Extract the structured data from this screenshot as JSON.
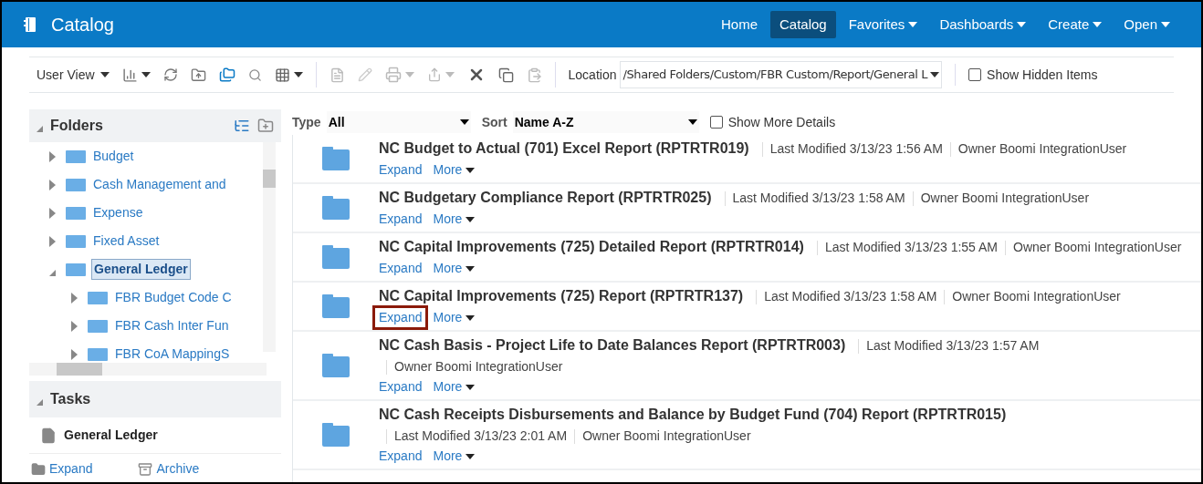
{
  "header": {
    "title": "Catalog",
    "nav": [
      {
        "label": "Home",
        "selected": false,
        "menu": false
      },
      {
        "label": "Catalog",
        "selected": true,
        "menu": false
      },
      {
        "label": "Favorites",
        "selected": false,
        "menu": true
      },
      {
        "label": "Dashboards",
        "selected": false,
        "menu": true
      },
      {
        "label": "Create",
        "selected": false,
        "menu": true
      },
      {
        "label": "Open",
        "selected": false,
        "menu": true
      }
    ]
  },
  "toolbar": {
    "view": "User View",
    "location_label": "Location",
    "location": "/Shared Folders/Custom/FBR Custom/Report/General L",
    "show_hidden": {
      "label": "Show Hidden Items",
      "checked": false
    }
  },
  "folders": {
    "title": "Folders",
    "expanded": true,
    "tree": [
      {
        "label": "Budget",
        "expanded": false,
        "selected": false
      },
      {
        "label": "Cash Management and",
        "expanded": false,
        "selected": false
      },
      {
        "label": "Expense",
        "expanded": false,
        "selected": false
      },
      {
        "label": "Fixed Asset",
        "expanded": false,
        "selected": false
      },
      {
        "label": "General Ledger",
        "expanded": true,
        "selected": true,
        "children": [
          {
            "label": "FBR Budget Code C",
            "expanded": false,
            "selected": false
          },
          {
            "label": "FBR Cash Inter Fun",
            "expanded": false,
            "selected": false
          },
          {
            "label": "FBR CoA MappingS",
            "expanded": false,
            "selected": false
          }
        ]
      }
    ]
  },
  "tasks": {
    "title": "Tasks",
    "expanded": true,
    "item": "General Ledger",
    "actions": [
      "Expand",
      "Archive"
    ]
  },
  "filters": {
    "type_label": "Type",
    "type": "All",
    "sort_label": "Sort",
    "sort": "Name A-Z",
    "show_more": {
      "label": "Show More Details",
      "checked": false
    }
  },
  "items": [
    {
      "title": "NC Budget to Actual (701) Excel Report (RPTRTR019)",
      "details": [
        "Last Modified 3/13/23 1:56 AM",
        "Owner Boomi IntegrationUser"
      ],
      "expand": "Expand",
      "more": "More",
      "highlighted": false
    },
    {
      "title": "NC Budgetary Compliance Report (RPTRTR025)",
      "details": [
        "Last Modified 3/13/23 1:58 AM",
        "Owner Boomi IntegrationUser"
      ],
      "expand": "Expand",
      "more": "More",
      "highlighted": false
    },
    {
      "title": "NC Capital Improvements (725) Detailed Report (RPTRTR014)",
      "details": [
        "Last Modified 3/13/23 1:55 AM",
        "Owner Boomi IntegrationUser"
      ],
      "expand": "Expand",
      "more": "More",
      "highlighted": false
    },
    {
      "title": "NC Capital Improvements (725) Report (RPTRTR137)",
      "details": [
        "Last Modified 3/13/23 1:58 AM",
        "Owner Boomi IntegrationUser"
      ],
      "expand": "Expand",
      "more": "More",
      "highlighted": true
    },
    {
      "title": "NC Cash Basis - Project Life to Date Balances Report (RPTRTR003)",
      "details": [
        "Last Modified 3/13/23 1:57 AM",
        "Owner Boomi IntegrationUser"
      ],
      "expand": "Expand",
      "more": "More",
      "highlighted": false
    },
    {
      "title": "NC Cash Receipts Disbursements and Balance by Budget Fund (704) Report (RPTRTR015)",
      "details": [
        "Last Modified 3/13/23 2:01 AM",
        "Owner Boomi IntegrationUser"
      ],
      "expand": "Expand",
      "more": "More",
      "highlighted": false
    }
  ]
}
